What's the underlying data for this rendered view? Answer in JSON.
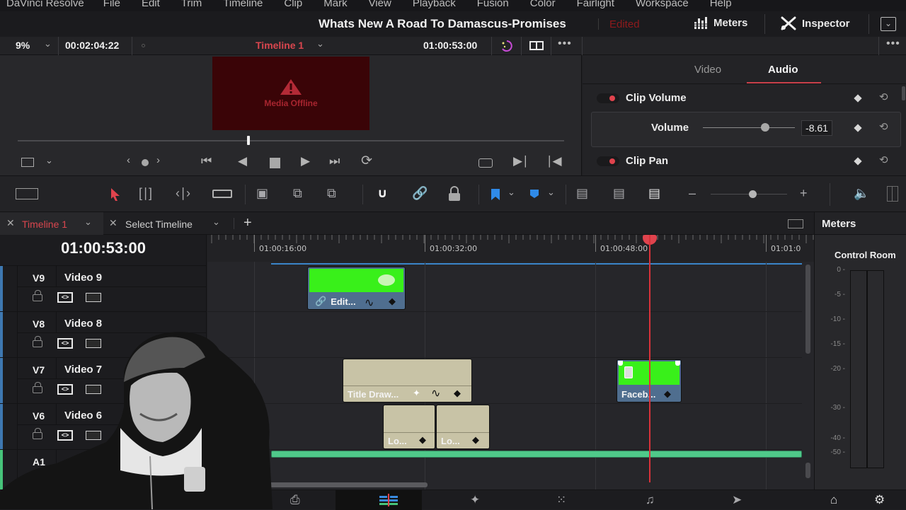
{
  "menu": [
    "DaVinci Resolve",
    "File",
    "Edit",
    "Trim",
    "Timeline",
    "Clip",
    "Mark",
    "View",
    "Playback",
    "Fusion",
    "Color",
    "Fairlight",
    "Workspace",
    "Help"
  ],
  "project": {
    "title": "Whats New A Road To Damascus-Promises",
    "status": "Edited"
  },
  "topbar": {
    "meters_label": "Meters",
    "inspector_label": "Inspector"
  },
  "viewer": {
    "zoom": "9%",
    "duration": "00:02:04:22",
    "timeline_name": "Timeline 1",
    "timecode": "01:00:53:00",
    "offline_label": "Media Offline",
    "scrub_position": 0.42
  },
  "inspector": {
    "tabs": [
      "Video",
      "Audio"
    ],
    "active_tab": "Audio",
    "clip_volume_label": "Clip Volume",
    "volume_label": "Volume",
    "volume_value": "-8.61",
    "volume_slider_fraction": 0.68,
    "clip_pan_label": "Clip Pan"
  },
  "timeline_tabs": {
    "tab1": "Timeline 1",
    "tab2": "Select Timeline"
  },
  "timeline": {
    "timecode": "01:00:53:00",
    "zoom_slider_fraction": 0.55,
    "ruler_labels": [
      "01:00:16:00",
      "01:00:32:00",
      "01:00:48:00",
      "01:01:0"
    ],
    "tracks": [
      {
        "id": "V9",
        "name": "Video 9"
      },
      {
        "id": "V8",
        "name": "Video 8"
      },
      {
        "id": "V7",
        "name": "Video 7"
      },
      {
        "id": "V6",
        "name": "Video 6"
      },
      {
        "id": "A1",
        "name": ""
      }
    ],
    "clips": {
      "edit": "Edit...",
      "title": "Title Draw...",
      "lo1": "Lo...",
      "lo2": "Lo...",
      "faceb": "Faceb..."
    }
  },
  "meters": {
    "title": "Meters",
    "subtitle": "Control Room",
    "scale": [
      "0 -",
      "-5 -",
      "-10 -",
      "-15 -",
      "-20 -",
      "-30 -",
      "-40 -",
      "-50 -"
    ]
  },
  "colors": {
    "accent_red": "#e0434d",
    "clip_green": "#39f01a",
    "clip_blue": "#4f6e8f",
    "title_clip": "#c8c3a6",
    "audio_green": "#4fc98a"
  }
}
